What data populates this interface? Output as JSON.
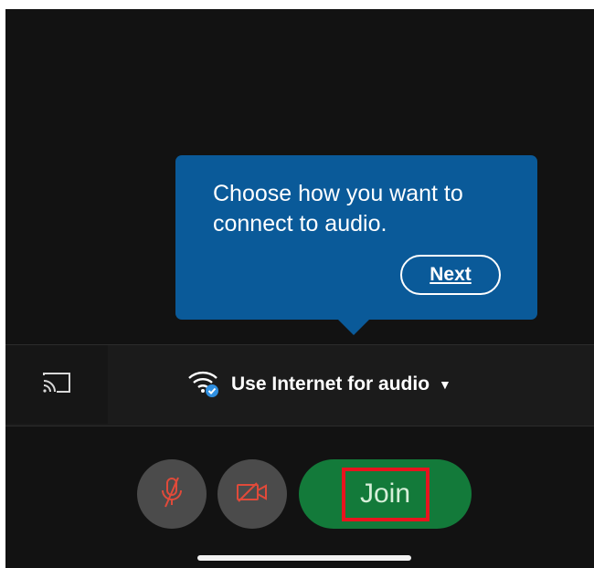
{
  "tooltip": {
    "message": "Choose how you want to connect to audio.",
    "next_label": "Next"
  },
  "audio_bar": {
    "option_label": "Use Internet for audio",
    "option_icon": "wifi-icon",
    "cast_icon": "screen-cast-icon",
    "dropdown_icon": "caret-down-icon"
  },
  "controls": {
    "mic_icon": "microphone-muted-icon",
    "camera_icon": "camera-off-icon",
    "join_label": "Join",
    "join_color": "#137a3a",
    "muted_icon_color": "#e04a3a",
    "highlight_color": "#e8141e"
  },
  "colors": {
    "tooltip_bg": "#0a5a99",
    "background": "#121212"
  }
}
